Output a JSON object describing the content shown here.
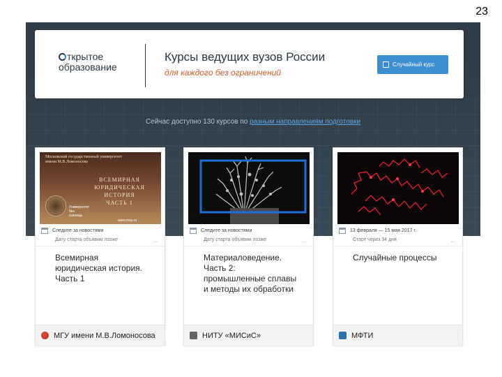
{
  "slide": {
    "number": "23"
  },
  "header": {
    "logo_o": "",
    "logo_line1": "ткрытое",
    "logo_line2": "образование",
    "title": "Курсы ведущих вузов России",
    "subtitle": "для каждого без ограничений",
    "random_button": "Случайный курс"
  },
  "courses_line": {
    "prefix": "Сейчас доступно 130 курсов по ",
    "link": "разным направлениям подготовки"
  },
  "cards": [
    {
      "image": {
        "top_text": "Московский государственный университет\nимени М.В.Ломоносова",
        "main_text": "ВСЕМИРНАЯ\nЮРИДИЧЕСКАЯ ИСТОРИЯ\nЧАСТЬ 1",
        "uni_text": "Университет\nбез\nграницы",
        "url": "www.msu.ru"
      },
      "meta1": "Следите за новостями",
      "meta2": "Дату старта объявим позже",
      "dots": "...",
      "title": "Всемирная\nюридическая история.\nЧасть 1",
      "university": "МГУ имени М.В.Ломоносова",
      "icon_color": "#c0392b"
    },
    {
      "meta1": "Следите за новостями",
      "meta2": "Дату старта объявим позже",
      "dots": "...",
      "title": "Материаловедение.\nЧасть 2:\nпромышленные сплавы\nи методы их обработки",
      "university": "НИТУ «МИСиС»",
      "icon_color": "#555555"
    },
    {
      "meta1": "13 февраля — 15 мая 2017 г.",
      "meta2": "Старт через 34 дня",
      "dots": "...",
      "title": "Случайные процессы",
      "university": "МФТИ",
      "icon_color": "#2e6fb0"
    }
  ],
  "colors": {
    "accent": "#3c8fd0",
    "subtitle": "#e05a2a",
    "background": "#2f3b45"
  }
}
